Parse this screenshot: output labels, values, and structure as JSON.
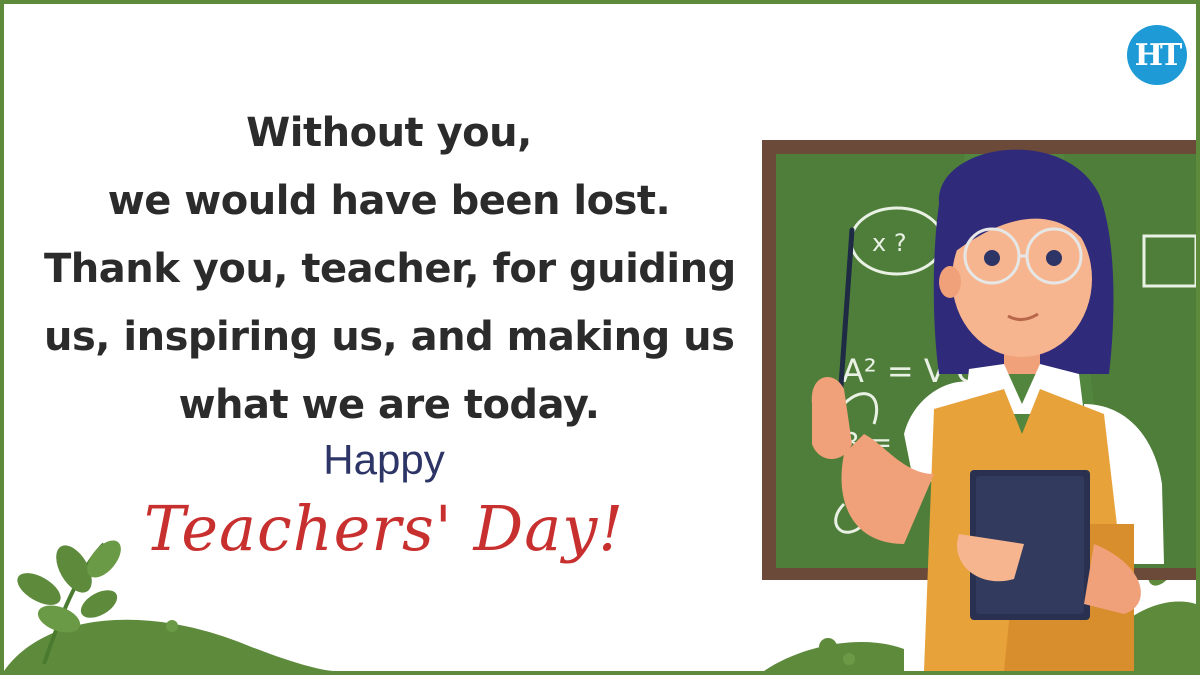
{
  "message": {
    "lines": [
      "Without you,",
      "we would have been lost.",
      "Thank you, teacher, for guiding",
      "us, inspiring us, and making us",
      "what we are today."
    ]
  },
  "greeting": {
    "happy": "Happy",
    "occasion": "Teachers' Day!"
  },
  "logo": {
    "text": "HT",
    "color": "#1e9ad6"
  },
  "board": {
    "note_1": "x ?",
    "formula": "A² = V C",
    "formula_2": "3 ="
  },
  "colors": {
    "border": "#5e8a3c",
    "board": "#4e7e3a",
    "board_frame": "#6b4a3a",
    "text": "#2b2b2b",
    "happy": "#2d3466",
    "occasion": "#c8302f"
  },
  "icons": [
    "leaf-icon",
    "teacher-illustration",
    "chalkboard",
    "pointer-stick",
    "book"
  ]
}
